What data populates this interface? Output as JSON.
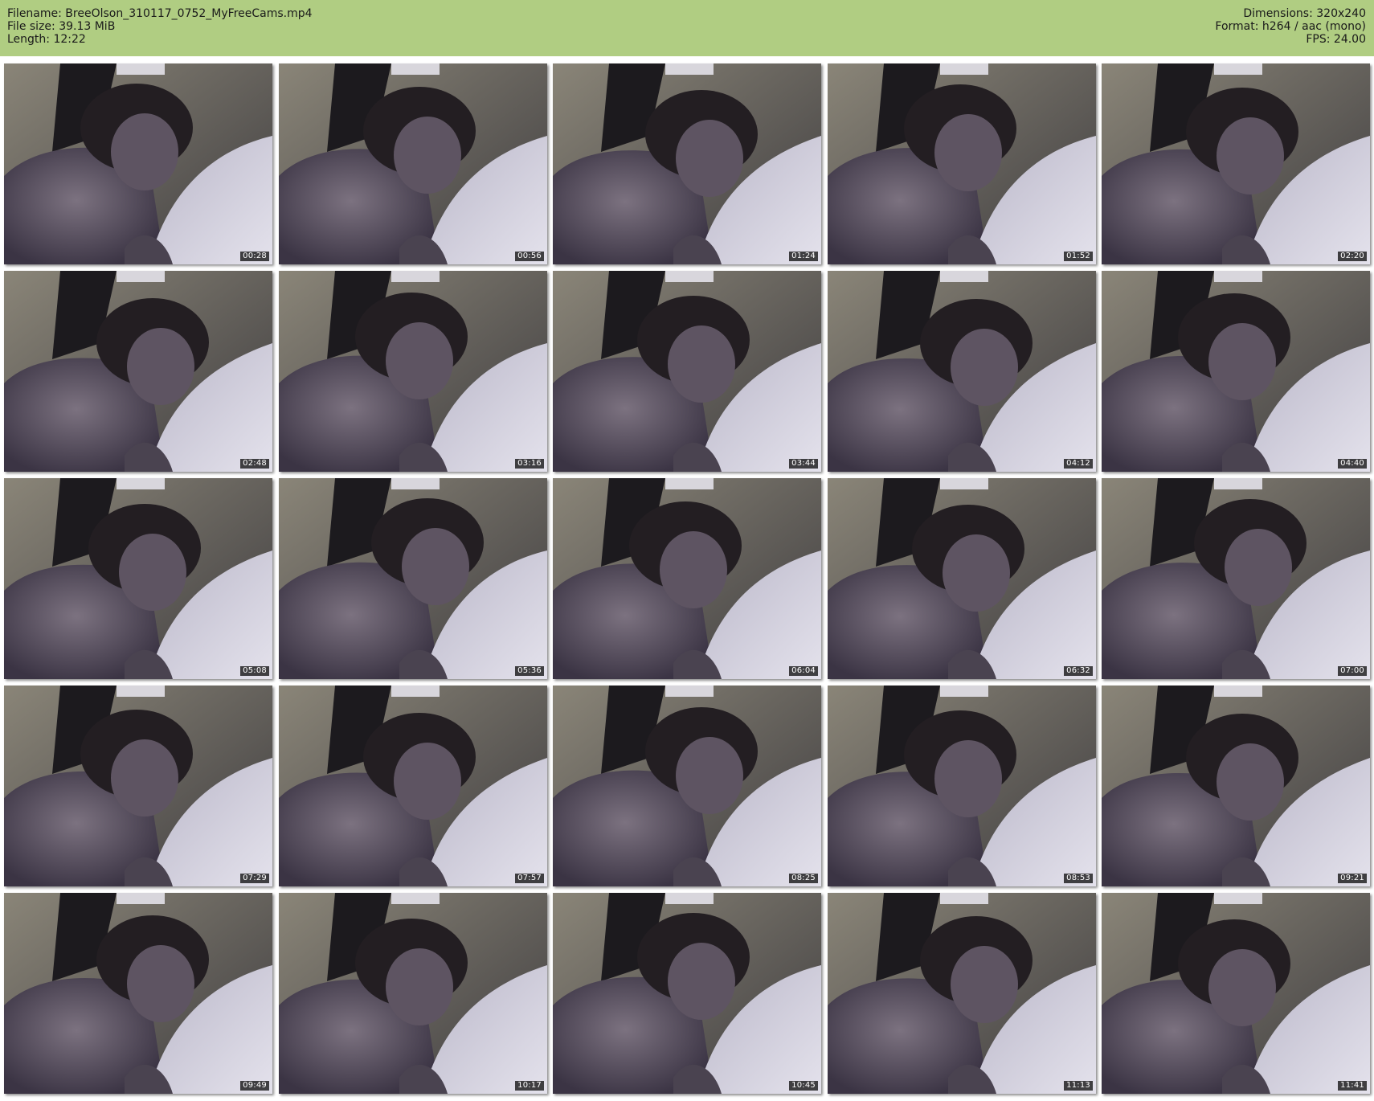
{
  "header": {
    "filename_label": "Filename: BreeOlson_310117_0752_MyFreeCams.mp4",
    "filesize_label": "File size: 39.13 MiB",
    "length_label": "Length: 12:22",
    "dimensions_label": "Dimensions: 320x240",
    "format_label": "Format: h264 / aac (mono)",
    "fps_label": "FPS: 24.00",
    "background_color": "#b0cd82"
  },
  "thumbnails": [
    {
      "timestamp": "00:28"
    },
    {
      "timestamp": "00:56"
    },
    {
      "timestamp": "01:24"
    },
    {
      "timestamp": "01:52"
    },
    {
      "timestamp": "02:20"
    },
    {
      "timestamp": "02:48"
    },
    {
      "timestamp": "03:16"
    },
    {
      "timestamp": "03:44"
    },
    {
      "timestamp": "04:12"
    },
    {
      "timestamp": "04:40"
    },
    {
      "timestamp": "05:08"
    },
    {
      "timestamp": "05:36"
    },
    {
      "timestamp": "06:04"
    },
    {
      "timestamp": "06:32"
    },
    {
      "timestamp": "07:00"
    },
    {
      "timestamp": "07:29"
    },
    {
      "timestamp": "07:57"
    },
    {
      "timestamp": "08:25"
    },
    {
      "timestamp": "08:53"
    },
    {
      "timestamp": "09:21"
    },
    {
      "timestamp": "09:49"
    },
    {
      "timestamp": "10:17"
    },
    {
      "timestamp": "10:45"
    },
    {
      "timestamp": "11:13"
    },
    {
      "timestamp": "11:41"
    }
  ]
}
